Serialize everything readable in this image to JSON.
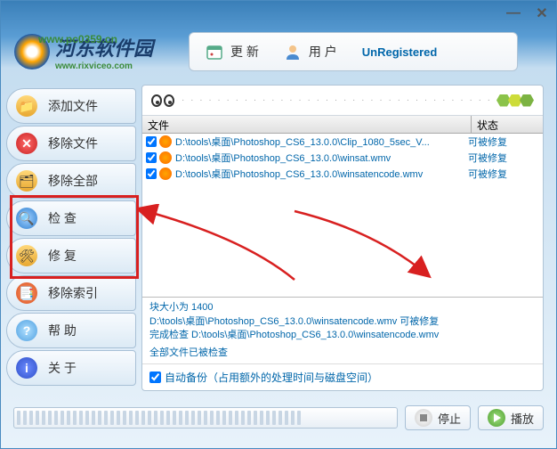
{
  "titlebar": {
    "min": "—",
    "close": "✕"
  },
  "header": {
    "logo_cn": "河东软件园",
    "logo_url": "www.pc0359.cn",
    "logo_sub": "www.rixviceo.com",
    "update": "更 新",
    "user": "用 户",
    "unregistered": "UnRegistered"
  },
  "sidebar": {
    "add": "添加文件",
    "remove": "移除文件",
    "removeall": "移除全部",
    "check": "检 查",
    "repair": "修 复",
    "removeidx": "移除索引",
    "help": "帮 助",
    "about": "关 于"
  },
  "table": {
    "col_file": "文件",
    "col_status": "状态",
    "rows": [
      {
        "path": "D:\\tools\\桌面\\Photoshop_CS6_13.0.0\\Clip_1080_5sec_V...",
        "status": "可被修复"
      },
      {
        "path": "D:\\tools\\桌面\\Photoshop_CS6_13.0.0\\winsat.wmv",
        "status": "可被修复"
      },
      {
        "path": "D:\\tools\\桌面\\Photoshop_CS6_13.0.0\\winsatencode.wmv",
        "status": "可被修复"
      }
    ]
  },
  "log": {
    "l1": "块大小为 1400",
    "l2": "D:\\tools\\桌面\\Photoshop_CS6_13.0.0\\winsatencode.wmv 可被修复",
    "l3": "完成检查 D:\\tools\\桌面\\Photoshop_CS6_13.0.0\\winsatencode.wmv",
    "l4": "全部文件已被检查"
  },
  "autobackup": "自动备份（占用额外的处理时间与磁盘空间）",
  "footer": {
    "stop": "停止",
    "play": "播放"
  }
}
